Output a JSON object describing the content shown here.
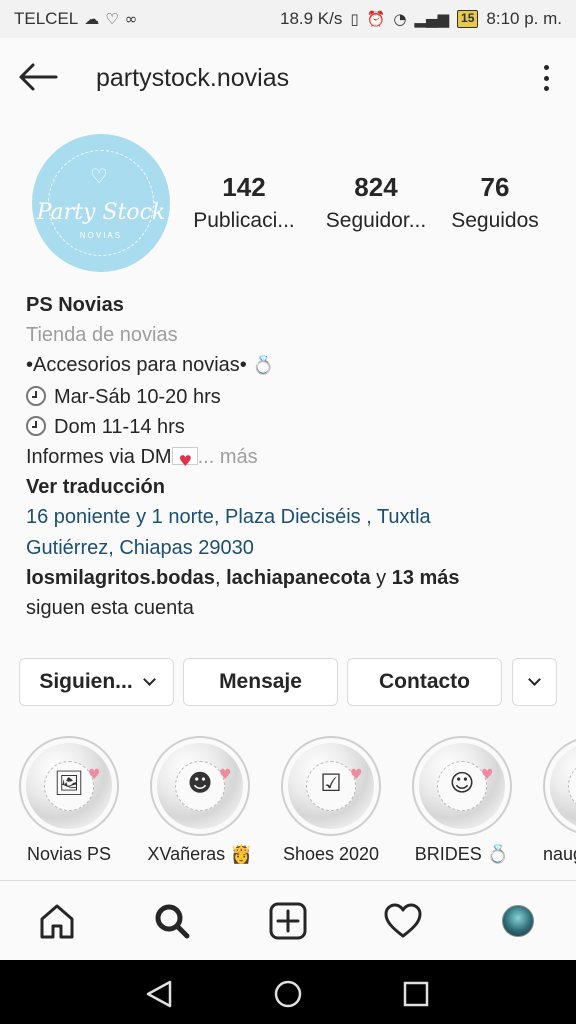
{
  "status_bar": {
    "carrier": "TELCEL",
    "speed": "18.9 K/s",
    "battery": "15",
    "time": "8:10 p. m."
  },
  "header": {
    "username": "partystock.novias"
  },
  "avatar": {
    "logo_text": "Party Stock",
    "logo_sub": "NOVIAS"
  },
  "stats": [
    {
      "count": "142",
      "label": "Publicaci..."
    },
    {
      "count": "824",
      "label": "Seguidor..."
    },
    {
      "count": "76",
      "label": "Seguidos"
    }
  ],
  "bio": {
    "name": "PS Novias",
    "category": "Tienda de novias",
    "line1": "•Accesorios para novias•",
    "line2": "Mar-Sáb 10-20 hrs",
    "line3": "Dom 11-14 hrs",
    "line4": "Informes via DM",
    "more": "... más",
    "translate": "Ver traducción",
    "address_line1": "16 poniente y 1 norte, Plaza Dieciséis , Tuxtla",
    "address_line2": "Gutiérrez, Chiapas 29030",
    "followers_a": "losmilagritos.bodas",
    "followers_sep": ", ",
    "followers_b": "lachiapanecota",
    "followers_and": " y ",
    "followers_more": "13 más",
    "followers_tail": "siguen esta cuenta"
  },
  "buttons": {
    "following": "Siguien...",
    "message": "Mensaje",
    "contact": "Contacto"
  },
  "highlights": [
    {
      "label": "Novias PS",
      "icon": "photo-frame-icon"
    },
    {
      "label": "XVañeras 👸",
      "icon": "girl-silhouette-icon"
    },
    {
      "label": "Shoes 2020",
      "icon": "checklist-icon"
    },
    {
      "label": "BRIDES 💍",
      "icon": "bride-silhouette-icon"
    },
    {
      "label": "Inaug",
      "icon": "highlight-icon"
    }
  ],
  "nav": [
    "home-icon",
    "search-icon",
    "new-post-icon",
    "activity-heart-icon",
    "profile-avatar-icon"
  ],
  "colors": {
    "avatar_bg": "#a8dcee",
    "address_link": "#1b4f72",
    "muted": "#9e9e9e"
  }
}
